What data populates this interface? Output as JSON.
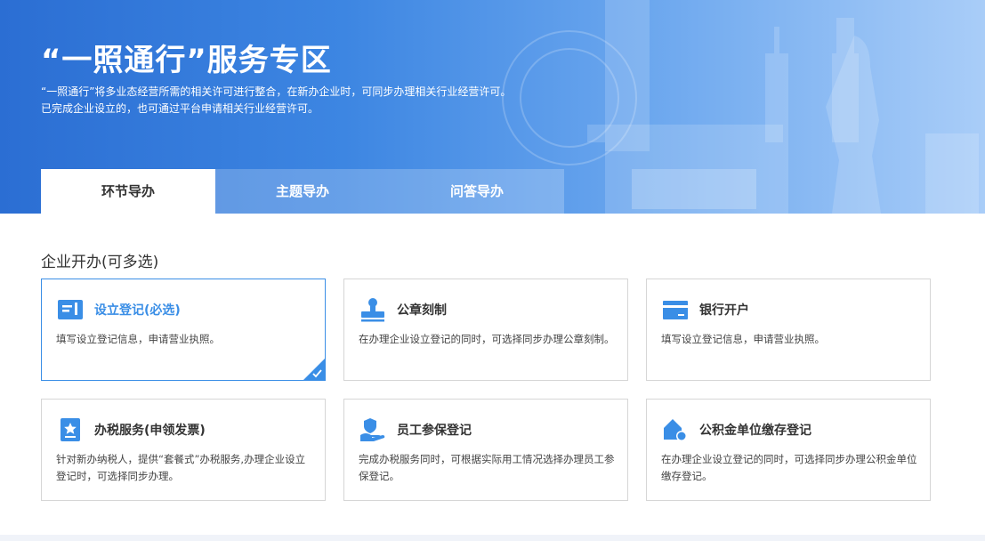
{
  "hero": {
    "title": "“一照通行”服务专区",
    "desc_line1": "“一照通行”将多业态经营所需的相关许可进行整合，在新办企业时，可同步办理相关行业经营许可。",
    "desc_line2": "已完成企业设立的，也可通过平台申请相关行业经营许可。",
    "colors": {
      "gradient_start": "#2b6ed3",
      "gradient_end": "#a9cdf8"
    }
  },
  "tabs": [
    {
      "label": "环节导办",
      "active": true
    },
    {
      "label": "主题导办",
      "active": false
    },
    {
      "label": "问答导办",
      "active": false
    }
  ],
  "section": {
    "title": "企业开办(可多选)"
  },
  "cards": [
    {
      "title": "设立登记(必选)",
      "desc": "填写设立登记信息，申请营业执照。",
      "icon": "registration-form-icon",
      "selected": true
    },
    {
      "title": "公章刻制",
      "desc": "在办理企业设立登记的同时，可选择同步办理公章刻制。",
      "icon": "seal-stamp-icon",
      "selected": false
    },
    {
      "title": "银行开户",
      "desc": "填写设立登记信息，申请营业执照。",
      "icon": "bank-card-icon",
      "selected": false
    },
    {
      "title": "办税服务(申领发票)",
      "desc": "针对新办纳税人，提供“套餐式”办税服务,办理企业设立登记时，可选择同步办理。",
      "icon": "tax-badge-icon",
      "selected": false
    },
    {
      "title": "员工参保登记",
      "desc": "完成办税服务同时，可根据实际用工情况选择办理员工参保登记。",
      "icon": "insurance-hand-icon",
      "selected": false
    },
    {
      "title": "公积金单位缴存登记",
      "desc": "在办理企业设立登记的同时，可选择同步办理公积金单位缴存登记。",
      "icon": "housing-fund-icon",
      "selected": false
    }
  ],
  "colors": {
    "accent": "#3a8ee6",
    "card_border": "#d6d6d6"
  }
}
